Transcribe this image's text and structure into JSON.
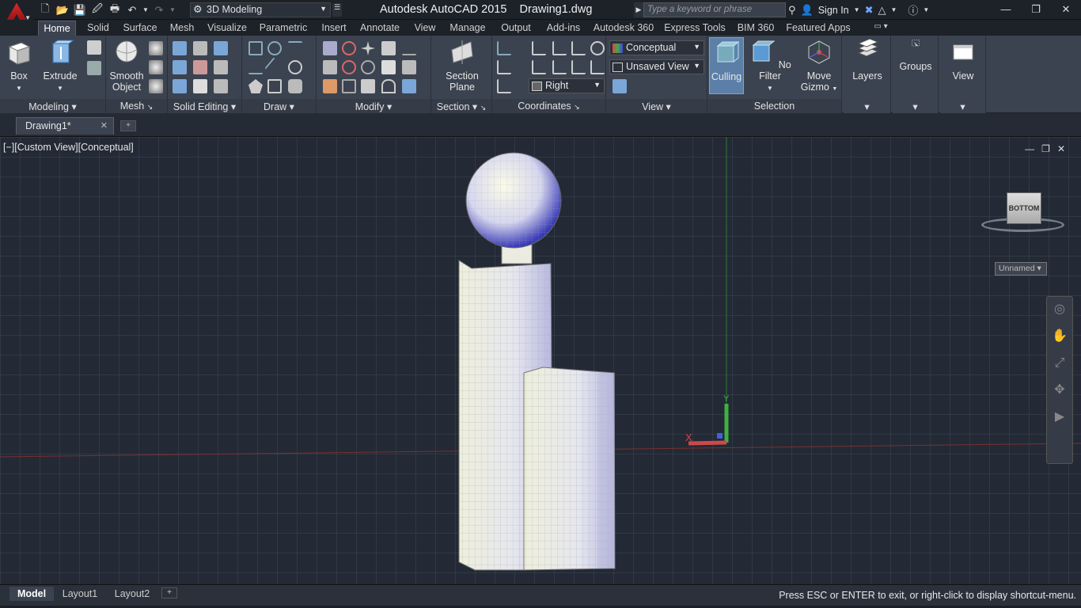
{
  "app": {
    "title": "Autodesk AutoCAD 2015    Drawing1.dwg",
    "workspace": "3D Modeling",
    "search_placeholder": "Type a keyword or phrase",
    "sign_in": "Sign In"
  },
  "tabs": [
    "Home",
    "Solid",
    "Surface",
    "Mesh",
    "Visualize",
    "Parametric",
    "Insert",
    "Annotate",
    "View",
    "Manage",
    "Output",
    "Add-ins",
    "Autodesk 360",
    "Express Tools",
    "BIM 360",
    "Featured Apps"
  ],
  "ribbon": {
    "box": "Box",
    "extrude": "Extrude",
    "smooth_object": [
      "Smooth",
      "Object"
    ],
    "section_plane": [
      "Section",
      "Plane"
    ],
    "visual_style": "Conceptual",
    "saved_view": "Unsaved View",
    "view_direction": "Right",
    "culling": "Culling",
    "no_filter": "No Filter",
    "move_gizmo": [
      "Move",
      "Gizmo"
    ],
    "layers": "Layers",
    "groups": "Groups",
    "view": "View",
    "panels": [
      "Modeling",
      "Mesh",
      "Solid Editing",
      "Draw",
      "Modify",
      "Section",
      "Coordinates",
      "View",
      "Selection"
    ]
  },
  "document": {
    "tab": "Drawing1*"
  },
  "viewport": {
    "label": "[−][Custom View][Conceptual]",
    "viewcube_face": "BOTTOM",
    "ucs_name": "Unnamed",
    "axis_y": "Y",
    "axis_x": "X"
  },
  "layout_tabs": [
    "Model",
    "Layout1",
    "Layout2"
  ],
  "status": "Press ESC or ENTER to exit, or right-click to display shortcut-menu."
}
